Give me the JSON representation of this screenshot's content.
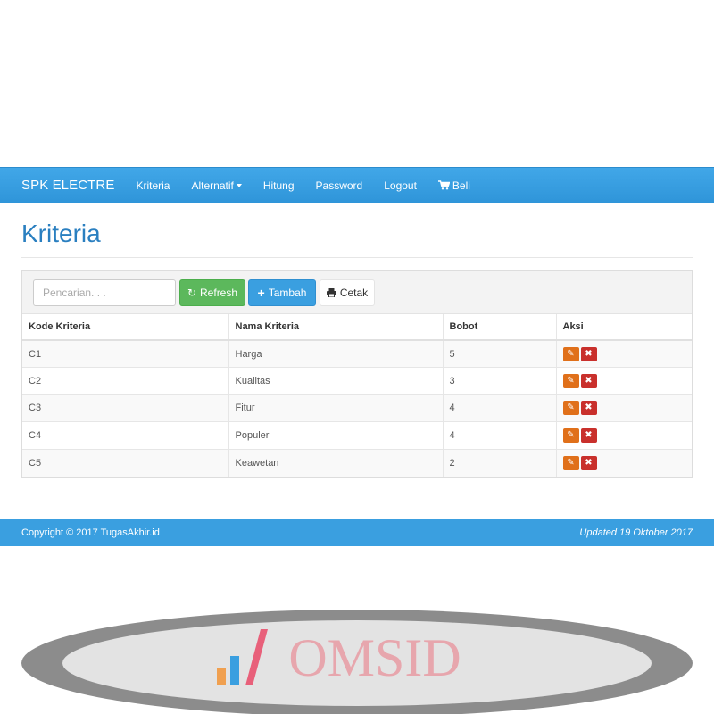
{
  "navbar": {
    "brand": "SPK ELECTRE",
    "items": [
      {
        "label": "Kriteria"
      },
      {
        "label": "Alternatif"
      },
      {
        "label": "Hitung"
      },
      {
        "label": "Password"
      },
      {
        "label": "Logout"
      },
      {
        "label": "Beli",
        "icon": "cart-icon"
      }
    ]
  },
  "page": {
    "title": "Kriteria"
  },
  "toolbar": {
    "search_placeholder": "Pencarian. . .",
    "refresh_label": "Refresh",
    "refresh_icon": "refresh-icon",
    "add_label": "Tambah",
    "add_icon": "plus-icon",
    "print_label": "Cetak",
    "print_icon": "print-icon"
  },
  "table": {
    "headers": [
      "Kode Kriteria",
      "Nama Kriteria",
      "Bobot",
      "Aksi"
    ],
    "rows": [
      {
        "kode": "C1",
        "nama": "Harga",
        "bobot": "5"
      },
      {
        "kode": "C2",
        "nama": "Kualitas",
        "bobot": "3"
      },
      {
        "kode": "C3",
        "nama": "Fitur",
        "bobot": "4"
      },
      {
        "kode": "C4",
        "nama": "Populer",
        "bobot": "4"
      },
      {
        "kode": "C5",
        "nama": "Keawetan",
        "bobot": "2"
      }
    ],
    "action_icons": [
      "edit-icon",
      "trash-icon"
    ]
  },
  "footer": {
    "copyright": "Copyright © 2017 TugasAkhir.id",
    "updated": "Updated 19 Oktober 2017"
  },
  "watermark": {
    "text": "OMSID"
  },
  "colors": {
    "navbar": "#3a9fe0",
    "title": "#2a7fc0",
    "refresh_button": "#5cb85c",
    "add_button": "#3a9fe0",
    "edit_button": "#e0701a",
    "delete_button": "#c9302c"
  }
}
